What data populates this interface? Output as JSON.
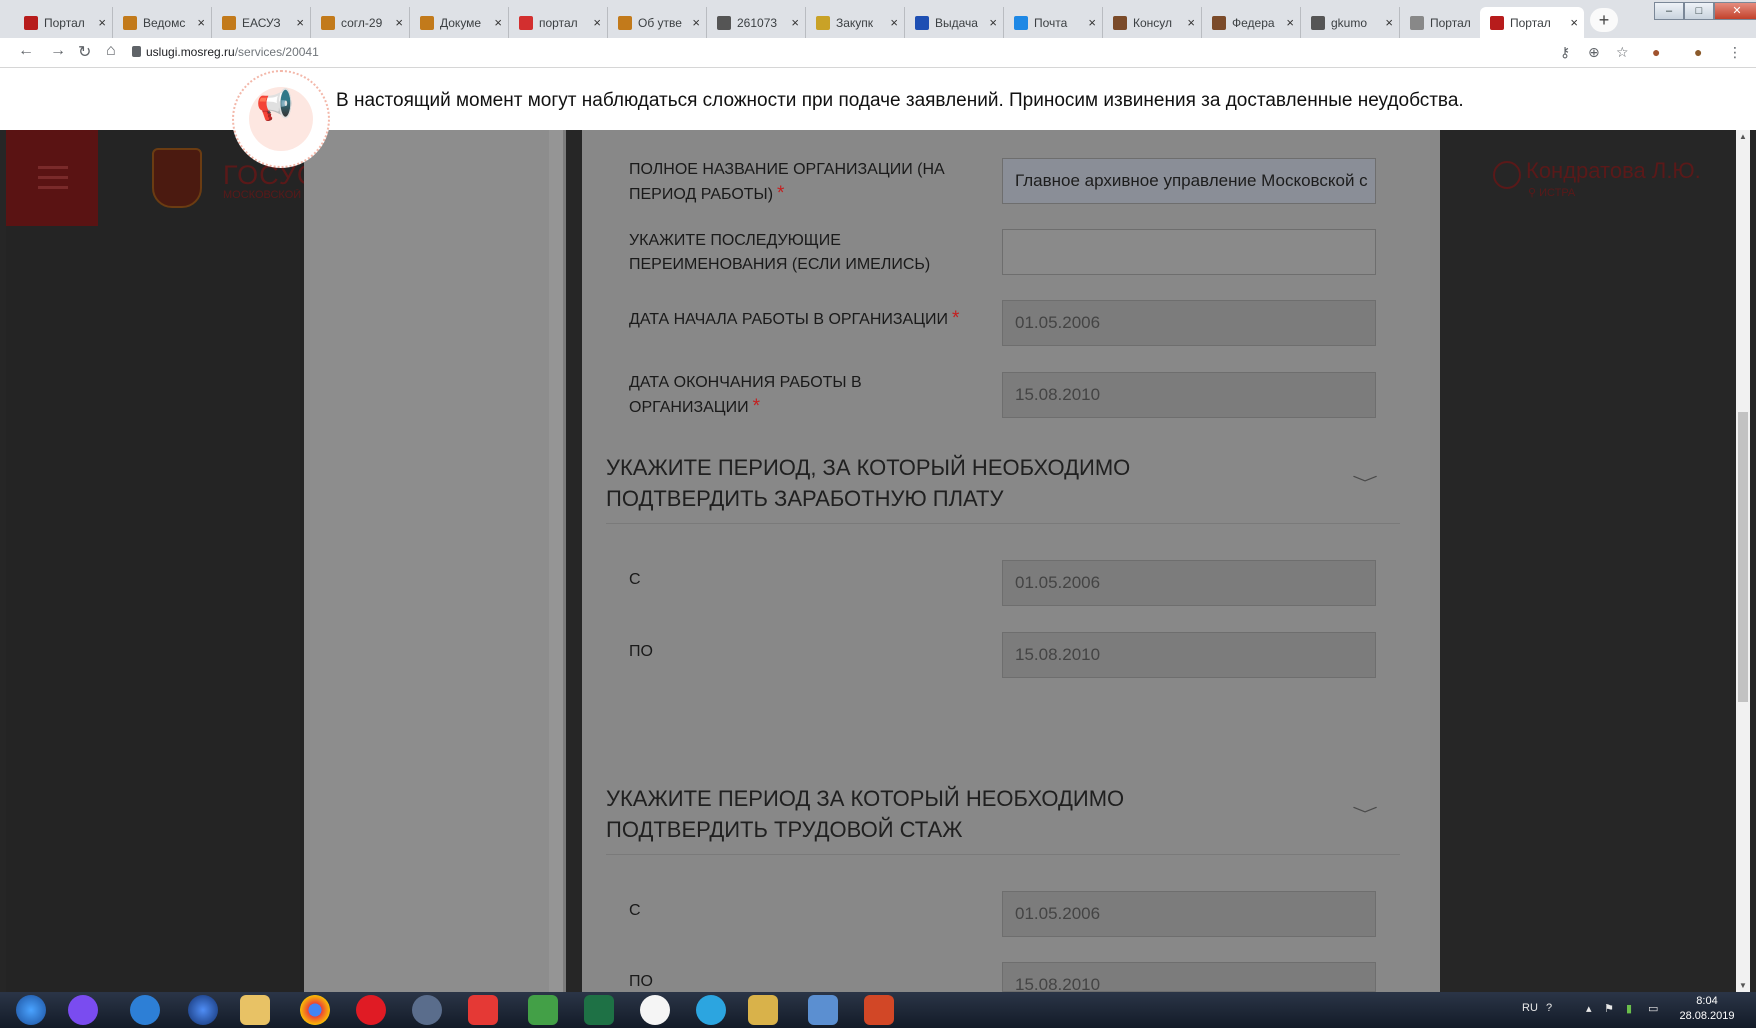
{
  "browser": {
    "tabs": [
      {
        "label": "Портал",
        "color": "#b71c1c"
      },
      {
        "label": "Ведомс",
        "color": "#c27a1b"
      },
      {
        "label": "ЕАСУЗ",
        "color": "#c27a1b"
      },
      {
        "label": "согл-29",
        "color": "#c27a1b"
      },
      {
        "label": "Докуме",
        "color": "#c27a1b"
      },
      {
        "label": "портал",
        "color": "#d32f2f"
      },
      {
        "label": "Об утве",
        "color": "#c27a1b"
      },
      {
        "label": "261073",
        "color": "#555555"
      },
      {
        "label": "Закупк",
        "color": "#c9a227"
      },
      {
        "label": "Выдача",
        "color": "#1e4fb3"
      },
      {
        "label": "Почта",
        "color": "#1e88e5"
      },
      {
        "label": "Консул",
        "color": "#7b4b2a"
      },
      {
        "label": "Федера",
        "color": "#7b4b2a"
      },
      {
        "label": "gkumo",
        "color": "#555555"
      },
      {
        "label": "Портал",
        "color": "#888888"
      },
      {
        "label": "Портал",
        "color": "#b71c1c"
      }
    ],
    "close_glyph": "×",
    "new_tab_glyph": "+",
    "url_host": "uslugi.mosreg.ru",
    "url_path": "/services/20041"
  },
  "notice": {
    "text": "В настоящий момент могут наблюдаться сложности при подаче заявлений. Приносим извинения за доставленные неудобства."
  },
  "header": {
    "logo_text": "ГОСУСЛ",
    "logo_sub": "МОСКОВСКОЙ",
    "user_name": "Кондратова Л.Ю.",
    "user_location": "ИСТРА"
  },
  "form": {
    "required_mark": "*",
    "fields": [
      {
        "label_line1": "ПОЛНОЕ НАЗВАНИЕ ОРГАНИЗАЦИИ (НА",
        "label_line2": "ПЕРИОД РАБОТЫ)",
        "value": "Главное архивное управление Московской с"
      },
      {
        "label_line1": "УКАЖИТЕ ПОСЛЕДУЮЩИЕ",
        "label_line2": "ПЕРЕИМЕНОВАНИЯ (ЕСЛИ ИМЕЛИСЬ)",
        "value": ""
      },
      {
        "label_line1": "ДАТА НАЧАЛА РАБОТЫ В ОРГАНИЗАЦИИ",
        "value": "01.05.2006"
      },
      {
        "label_line1": "ДАТА ОКОНЧАНИЯ РАБОТЫ В",
        "label_line2": "ОРГАНИЗАЦИИ",
        "value": "15.08.2010"
      }
    ],
    "section_salary": {
      "title_line1": "УКАЖИТЕ ПЕРИОД, ЗА КОТОРЫЙ НЕОБХОДИМО",
      "title_line2": "ПОДТВЕРДИТЬ ЗАРАБОТНУЮ ПЛАТУ",
      "from_label": "С",
      "from_value": "01.05.2006",
      "to_label": "ПО",
      "to_value": "15.08.2010"
    },
    "section_experience": {
      "title_line1": "УКАЖИТЕ ПЕРИОД ЗА КОТОРЫЙ НЕОБХОДИМО",
      "title_line2": "ПОДТВЕРДИТЬ ТРУДОВОЙ СТАЖ",
      "from_label": "С",
      "from_value": "01.05.2006",
      "to_label": "ПО",
      "to_value": "15.08.2010"
    },
    "chevron": "﹀"
  },
  "taskbar": {
    "lang": "RU",
    "time": "8:04",
    "date": "28.08.2019"
  }
}
